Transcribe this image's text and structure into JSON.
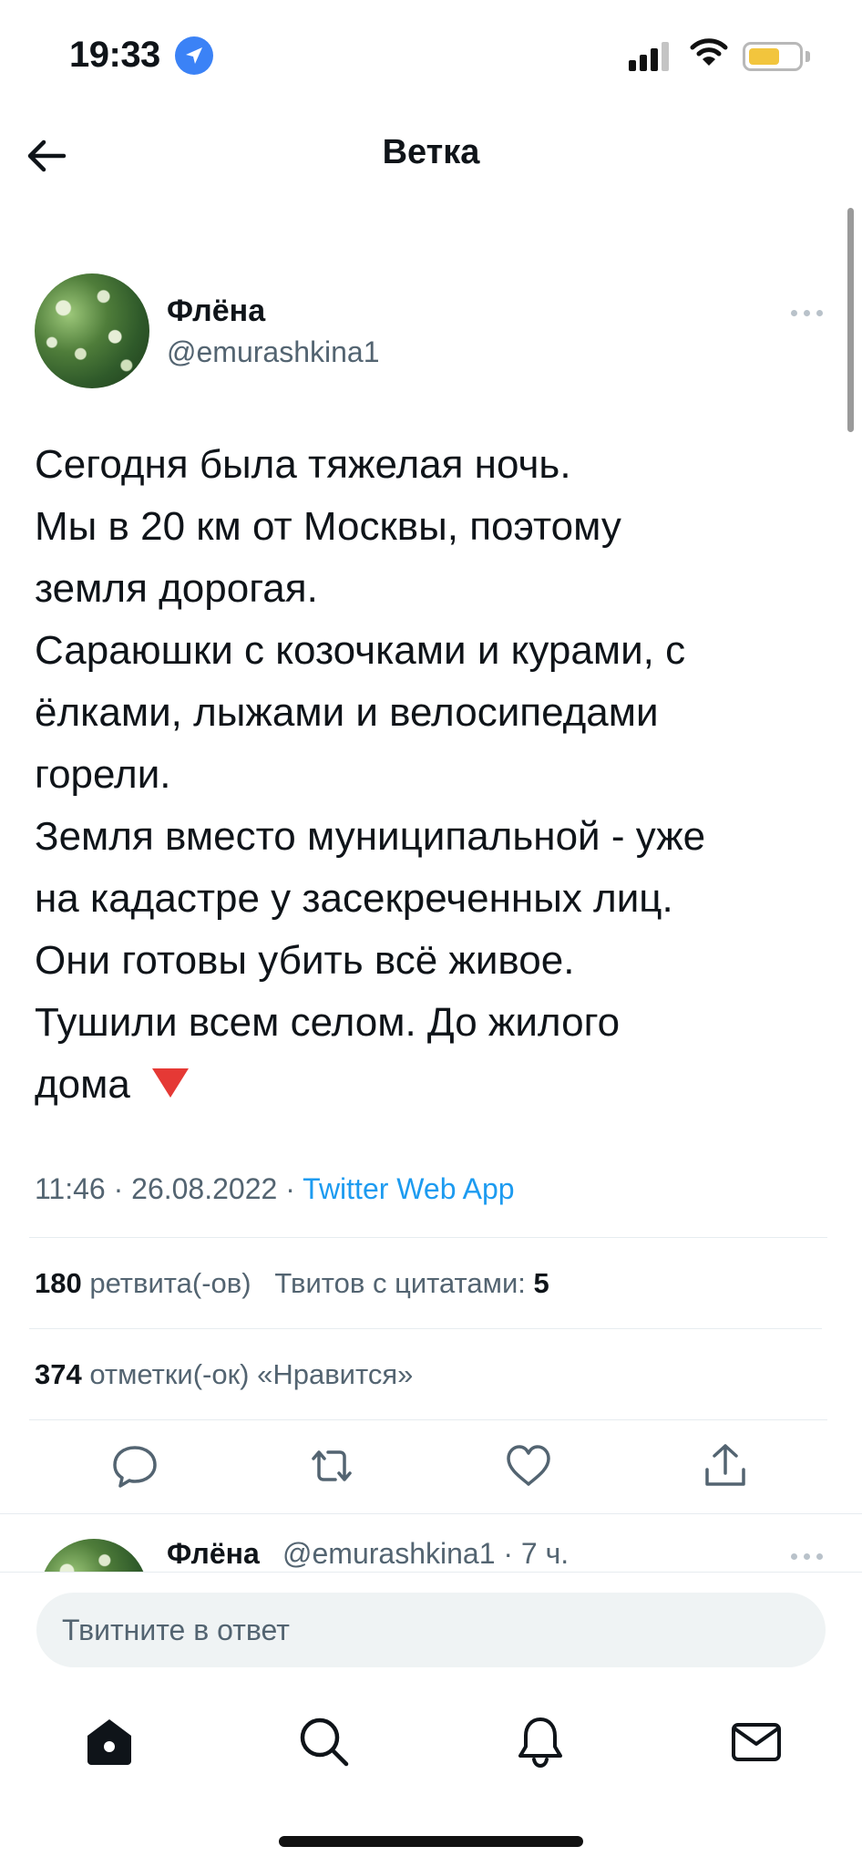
{
  "status_bar": {
    "time": "19:33"
  },
  "header": {
    "title": "Ветка"
  },
  "tweet": {
    "author_name": "Флёна",
    "author_handle": "@emurashkina1",
    "text_lines": [
      "Сегодня была тяжелая ночь.",
      "Мы в 20 км от Москвы, поэтому",
      "земля дорогая.",
      "Сараюшки с козочками и курами, с",
      "ёлками, лыжами и велосипедами",
      "горели.",
      "Земля вместо муниципальной - уже",
      "на кадастре у засекреченных лиц.",
      "Они готовы убить всё живое.",
      "Тушили всем селом. До жилого",
      "дома"
    ],
    "emoji": "red-triangle-down",
    "time": "11:46",
    "date": "26.08.2022",
    "separator": "·",
    "source": "Twitter Web App",
    "retweets_count": "180",
    "retweets_label": "ретвита(-ов)",
    "quotes_label": "Твитов с цитатами:",
    "quotes_count": "5",
    "likes_count": "374",
    "likes_label": "отметки(-ок) «Нравится»"
  },
  "actions": [
    "reply-icon",
    "retweet-icon",
    "like-icon",
    "share-icon"
  ],
  "reply_preview": {
    "author_name": "Флёна",
    "handle_time": "@emurashkina1 · 7 ч."
  },
  "reply_bar": {
    "placeholder": "Твитните в ответ"
  },
  "tab_bar": [
    "home-icon",
    "search-icon",
    "notifications-icon",
    "messages-icon"
  ],
  "colors": {
    "link": "#1d9bf0",
    "secondary_text": "#536471",
    "location_badge": "#3b82f6",
    "battery": "#f2c53d"
  }
}
